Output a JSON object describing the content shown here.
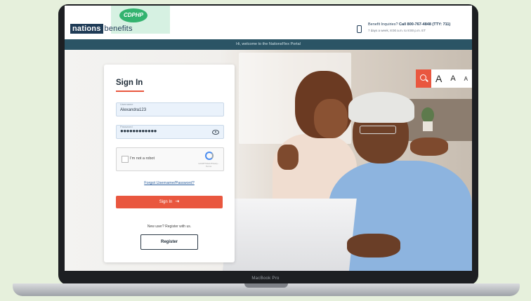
{
  "device": {
    "model_label": "MacBook Pro"
  },
  "header": {
    "logo_box_text": "nations",
    "logo_text": "benefits",
    "partner_logo_text": "CDPHP",
    "phone_line1_prefix": "Benefit Inquiries?",
    "phone_line1_number": "Call 800-767-4848 (TTY: 711)",
    "phone_line2": "7 days a week, 8:00 a.m. to 8:00 p.m. ET"
  },
  "banner": {
    "text": "Hi, welcome to the NationsFlex Portal"
  },
  "accessibility": {
    "font_large": "A",
    "font_medium": "A",
    "font_small": "A"
  },
  "signin": {
    "title": "Sign In",
    "username_label": "Username",
    "username_value": "Alexandra123",
    "password_label": "Password",
    "password_value": "●●●●●●●●●●●●",
    "captcha_label": "I'm not a robot",
    "captcha_terms": "reCAPTCHA Privacy - Terms",
    "forgot_link": "Forgot Username/Password?",
    "signin_button": "Sign In",
    "register_prompt": "New user? Register with us.",
    "register_button": "Register"
  },
  "colors": {
    "accent": "#e9573f",
    "brand_navy": "#1f3b56",
    "banner": "#2b5465",
    "page_background": "#e6f0dc"
  }
}
